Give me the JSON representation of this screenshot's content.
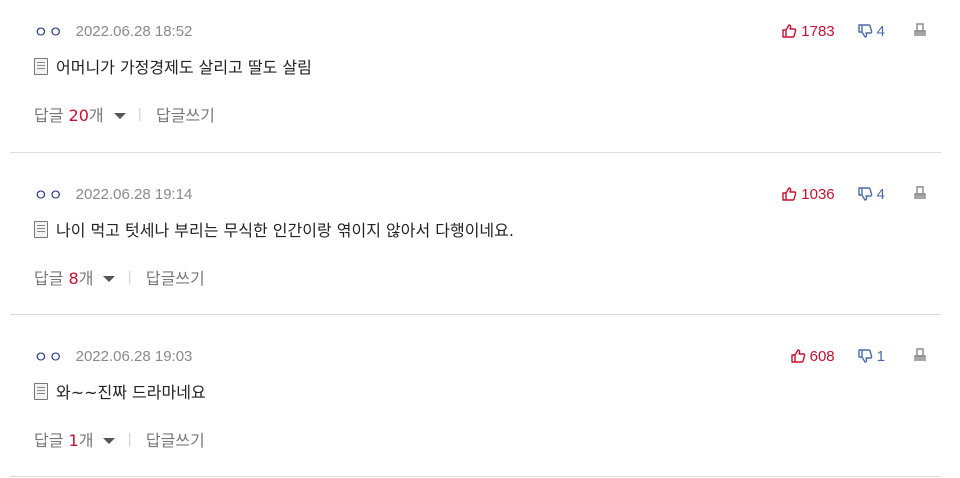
{
  "comments": [
    {
      "author": "ㅇㅇ",
      "date": "2022.06.28 18:52",
      "text": "어머니가 가정경제도 살리고 딸도 살림",
      "likes": "1783",
      "dislikes": "4",
      "reply_prefix": "답글 ",
      "reply_count": "20",
      "reply_suffix": "개",
      "separator": "|",
      "reply_write": "답글쓰기"
    },
    {
      "author": "ㅇㅇ",
      "date": "2022.06.28 19:14",
      "text": "나이 먹고 텃세나 부리는 무식한 인간이랑 엮이지 않아서 다행이네요.",
      "likes": "1036",
      "dislikes": "4",
      "reply_prefix": "답글 ",
      "reply_count": "8",
      "reply_suffix": "개",
      "separator": "|",
      "reply_write": "답글쓰기"
    },
    {
      "author": "ㅇㅇ",
      "date": "2022.06.28 19:03",
      "text": "와~~진짜 드라마네요",
      "likes": "608",
      "dislikes": "1",
      "reply_prefix": "답글 ",
      "reply_count": "1",
      "reply_suffix": "개",
      "separator": "|",
      "reply_write": "답글쓰기"
    }
  ],
  "icons": {
    "like": "thumbs-up-icon",
    "dislike": "thumbs-down-icon",
    "report": "report-icon",
    "document": "document-icon",
    "expand": "caret-down-icon"
  },
  "colors": {
    "author": "#2b3c8a",
    "like": "#c8102e",
    "dislike": "#4b6aa8",
    "reply_count": "#c8102e",
    "date": "#8a8a8a",
    "divider": "#dcdcdc"
  }
}
